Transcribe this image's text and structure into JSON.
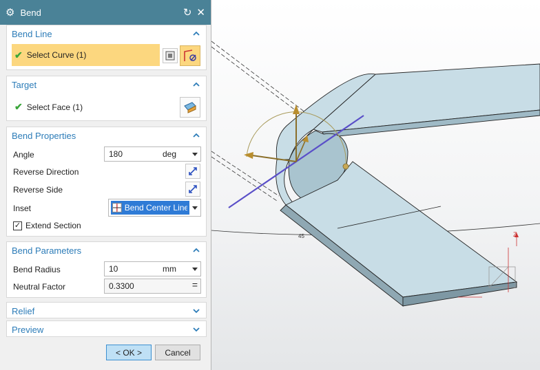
{
  "dialog": {
    "title": "Bend",
    "sections": {
      "bend_line": {
        "label": "Bend Line",
        "select_curve": "Select Curve (1)"
      },
      "target": {
        "label": "Target",
        "select_face": "Select Face (1)"
      },
      "bend_properties": {
        "label": "Bend Properties",
        "angle_label": "Angle",
        "angle_value": "180",
        "angle_unit": "deg",
        "reverse_direction_label": "Reverse Direction",
        "reverse_side_label": "Reverse Side",
        "inset_label": "Inset",
        "inset_value": "Bend Center Line",
        "extend_section_label": "Extend Section"
      },
      "bend_parameters": {
        "label": "Bend Parameters",
        "radius_label": "Bend Radius",
        "radius_value": "10",
        "radius_unit": "mm",
        "neutral_label": "Neutral Factor",
        "neutral_value": "0.3300",
        "neutral_symbol": "="
      },
      "relief": {
        "label": "Relief"
      },
      "preview": {
        "label": "Preview"
      }
    },
    "buttons": {
      "ok": "< OK >",
      "cancel": "Cancel"
    }
  },
  "viewport": {
    "dimension_text": "45",
    "axis_label": "Z"
  },
  "colors": {
    "title_bar": "#4a8297",
    "section_header": "#2c7cb8",
    "highlight": "#fcd77f",
    "check": "#3aa63a",
    "ok_button": "#bfe0f5",
    "part_face": "#c8dde6"
  }
}
